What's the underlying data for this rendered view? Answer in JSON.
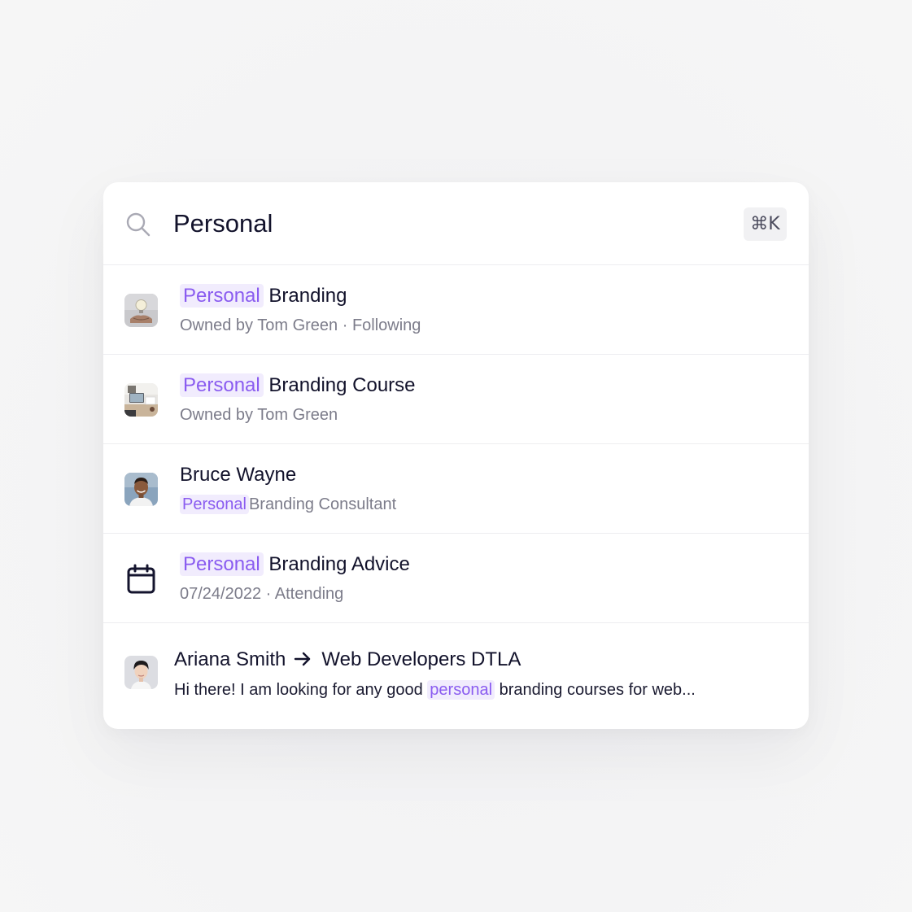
{
  "search": {
    "value": "Personal",
    "shortcut": "⌘K"
  },
  "results": [
    {
      "type": "community",
      "icon": "lightbulb-hand-image",
      "highlight": "Personal",
      "title_rest": "Branding",
      "subtitle": "Owned by Tom Green · Following"
    },
    {
      "type": "course",
      "icon": "desk-laptop-image",
      "highlight": "Personal",
      "title_rest": "Branding Course",
      "subtitle": "Owned by Tom Green"
    },
    {
      "type": "person",
      "icon": "avatar-bruce-wayne",
      "title": "Bruce Wayne",
      "highlight": "Personal",
      "subtitle_rest": "Branding Consultant"
    },
    {
      "type": "event",
      "icon": "calendar-icon",
      "highlight": "Personal",
      "title_rest": "Branding Advice",
      "subtitle": "07/24/2022 · Attending"
    },
    {
      "type": "message",
      "icon": "avatar-ariana-smith",
      "from": "Ariana Smith",
      "to": "Web Developers DTLA",
      "text_before": "Hi there! I am looking for any good",
      "highlight": "personal",
      "text_after": "branding courses for web..."
    }
  ],
  "colors": {
    "highlight_text": "#8a5cf0",
    "highlight_bg": "#f1ecfd",
    "title": "#12122b",
    "subtitle": "#7c7c8a"
  }
}
